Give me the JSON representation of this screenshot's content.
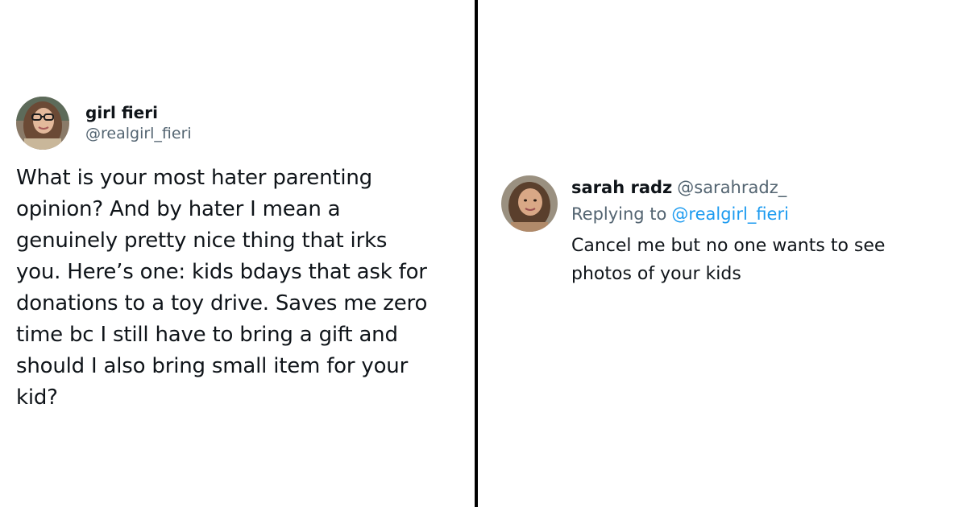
{
  "left_tweet": {
    "display_name": "girl fieri",
    "handle": "@realgirl_fieri",
    "text": "What is your most hater parenting\nopinion? And by hater I mean a\ngenuinely pretty nice thing that irks\nyou. Here’s one: kids bdays that ask for\ndonations to a toy drive. Saves me zero\ntime bc I still have to bring a gift and\nshould I also bring small item for your\nkid?",
    "avatar_icon": "profile-photo-woman-glasses"
  },
  "right_tweet": {
    "display_name": "sarah radz",
    "handle": "@sarahradz_",
    "replying_prefix": "Replying to",
    "replying_mention": "@realgirl_fieri",
    "text": "Cancel me but no one wants to see\nphotos of your kids",
    "avatar_icon": "profile-photo-woman"
  },
  "colors": {
    "text_primary": "#0f1419",
    "text_secondary": "#536471",
    "link": "#1d9bf0",
    "divider": "#000000"
  }
}
